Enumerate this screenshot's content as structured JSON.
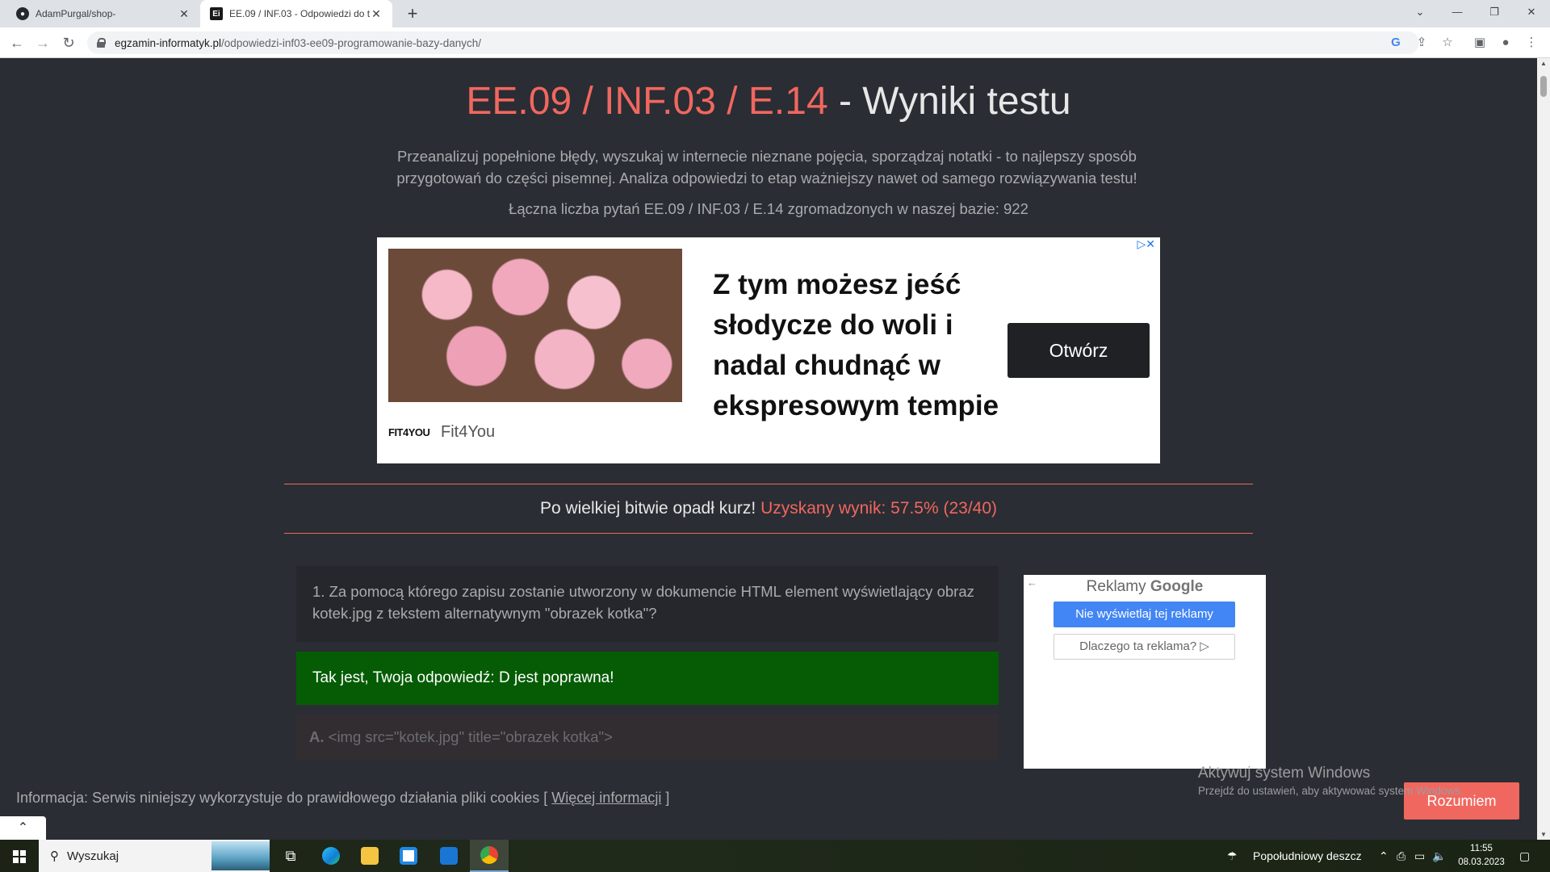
{
  "browser": {
    "tabs": [
      {
        "title": "AdamPurgal/shop-",
        "active": false
      },
      {
        "title": "EE.09 / INF.03 - Odpowiedzi do t",
        "active": true
      }
    ],
    "url_host": "egzamin-informatyk.pl",
    "url_path": "/odpowiedzi-inf03-ee09-programowanie-bazy-danych/"
  },
  "page": {
    "title_accent": "EE.09 / INF.03 / E.14",
    "title_rest": " - Wyniki testu",
    "lead": "Przeanalizuj popełnione błędy, wyszukaj w internecie nieznane pojęcia, sporządzaj notatki - to najlepszy sposób przygotowań do części pisemnej. Analiza odpowiedzi to etap ważniejszy nawet od samego rozwiązywania testu!",
    "count_text": "Łączna liczba pytań EE.09 / INF.03 / E.14 zgromadzonych w naszej bazie: 922",
    "result_text": "Po wielkiej bitwie opadł kurz! ",
    "result_score": "Uzyskany wynik: 57.5% (23/40)"
  },
  "ad": {
    "headline": "Z tym możesz jeść słodycze do woli i nadal chudnąć w ekspresowym tempie",
    "button": "Otwórz",
    "brand_logo": "FIT4YOU",
    "brand": "Fit4You"
  },
  "question": {
    "text": "1. Za pomocą którego zapisu zostanie utworzony w dokumencie HTML element wyświetlający obraz kotek.jpg z tekstem alternatywnym \"obrazek kotka\"?",
    "feedback": "Tak jest, Twoja odpowiedź: D jest poprawna!",
    "option_a_letter": "A.",
    "option_a_text": " <img src=\"kotek.jpg\" title=\"obrazek kotka\">"
  },
  "google_ads": {
    "title_prefix": "Reklamy ",
    "title_brand": "Google",
    "stop_label": "Nie wyświetlaj tej reklamy",
    "why_label": "Dlaczego ta reklama? ▷"
  },
  "cookie": {
    "text": "Informacja: Serwis niniejszy wykorzystuje do prawidłowego działania pliki cookies [ ",
    "link": "Więcej informacji",
    "text_end": " ]",
    "button": "Rozumiem"
  },
  "windows_watermark": {
    "line1": "Aktywuj system Windows",
    "line2": "Przejdź do ustawień, aby aktywować system Windows."
  },
  "taskbar": {
    "search_placeholder": "Wyszukaj",
    "weather": "Popołudniowy deszcz",
    "time": "11:55",
    "date": "08.03.2023"
  }
}
